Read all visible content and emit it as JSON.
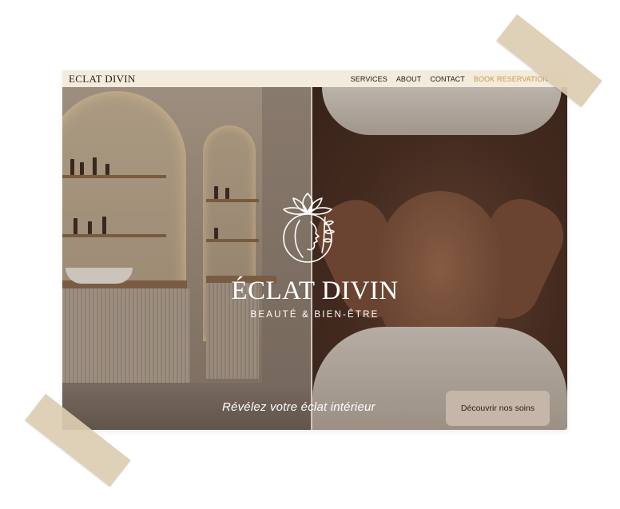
{
  "navbar": {
    "brand": "ECLAT DIVIN",
    "links": [
      "SERVICES",
      "ABOUT",
      "CONTACT"
    ],
    "book": "BOOK RESERVATION"
  },
  "hero": {
    "logo_icon": "lotus-profile-icon",
    "title": "ÉCLAT DIVIN",
    "subtitle": "BEAUTÉ & BIEN-ÊTRE",
    "tagline": "Révélez votre éclat intérieur",
    "cta_label": "Découvrir nos soins"
  },
  "colors": {
    "nav_bg": "#f3ebdc",
    "book_accent": "#c99a4a",
    "cta_bg": "#c9b9ac",
    "tape": "#ddcdb2"
  }
}
